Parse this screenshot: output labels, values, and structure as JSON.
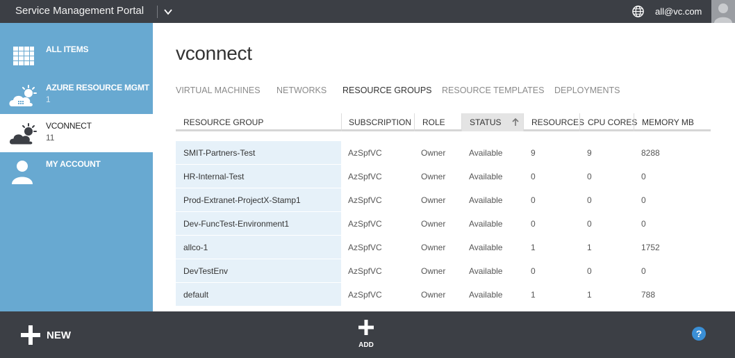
{
  "header": {
    "app_title": "Service Management Portal",
    "user_email": "all@vc.com"
  },
  "sidebar": {
    "items": [
      {
        "label": "ALL ITEMS",
        "count": "",
        "icon": "grid-icon"
      },
      {
        "label": "AZURE RESOURCE MGMT",
        "count": "1",
        "icon": "cloud-sun-icon"
      },
      {
        "label": "VCONNECT",
        "count": "11",
        "icon": "cloud-sun-icon",
        "active": true
      },
      {
        "label": "MY ACCOUNT",
        "count": "",
        "icon": "user-icon"
      }
    ]
  },
  "main": {
    "title": "vconnect",
    "tabs": [
      {
        "label": "VIRTUAL MACHINES"
      },
      {
        "label": "NETWORKS"
      },
      {
        "label": "RESOURCE GROUPS",
        "active": true
      },
      {
        "label": "RESOURCE TEMPLATES"
      },
      {
        "label": "DEPLOYMENTS"
      }
    ],
    "columns": [
      "RESOURCE GROUP",
      "SUBSCRIPTION",
      "ROLE",
      "STATUS",
      "RESOURCES",
      "CPU CORES",
      "MEMORY MB"
    ],
    "sorted_column": "STATUS",
    "rows": [
      [
        "SMIT-Partners-Test",
        "AzSpfVC",
        "Owner",
        "Available",
        "9",
        "9",
        "8288"
      ],
      [
        "HR-Internal-Test",
        "AzSpfVC",
        "Owner",
        "Available",
        "0",
        "0",
        "0"
      ],
      [
        "Prod-Extranet-ProjectX-Stamp1",
        "AzSpfVC",
        "Owner",
        "Available",
        "0",
        "0",
        "0"
      ],
      [
        "Dev-FuncTest-Environment1",
        "AzSpfVC",
        "Owner",
        "Available",
        "0",
        "0",
        "0"
      ],
      [
        "allco-1",
        "AzSpfVC",
        "Owner",
        "Available",
        "1",
        "1",
        "1752"
      ],
      [
        "DevTestEnv",
        "AzSpfVC",
        "Owner",
        "Available",
        "0",
        "0",
        "0"
      ],
      [
        "default",
        "AzSpfVC",
        "Owner",
        "Available",
        "1",
        "1",
        "788"
      ]
    ]
  },
  "footer": {
    "new_label": "NEW",
    "add_label": "ADD"
  },
  "colors": {
    "topbar": "#3c3f45",
    "sidebar": "#68a9d1",
    "row_highlight": "#e6f1f9",
    "help": "#3a8fd6"
  }
}
